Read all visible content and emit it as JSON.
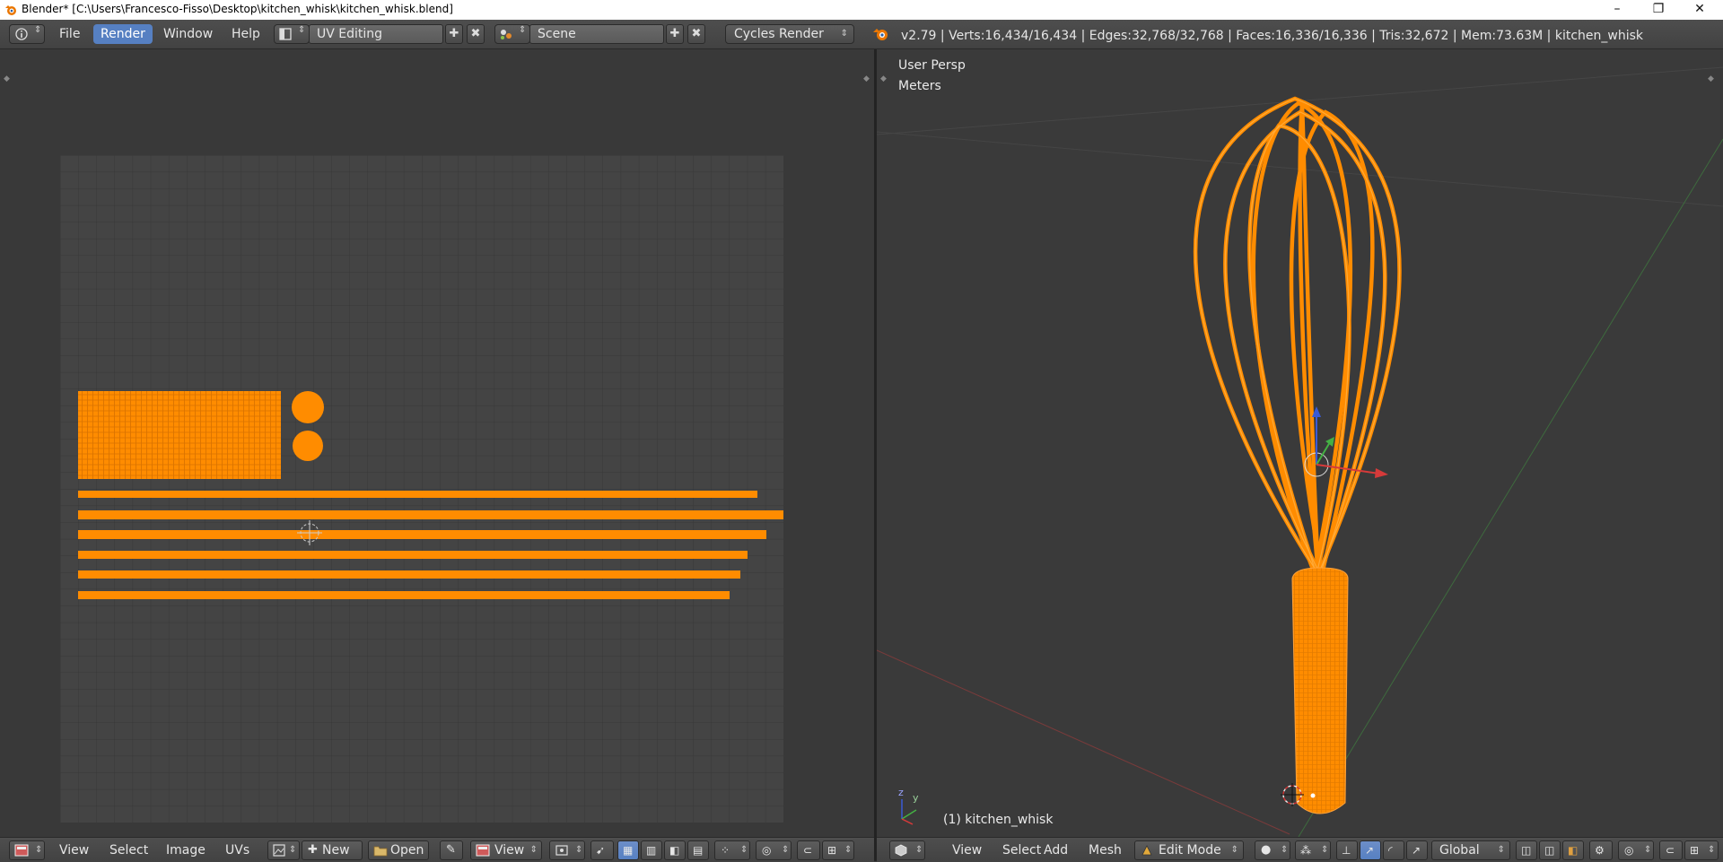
{
  "window": {
    "title": "Blender* [C:\\Users\\Francesco-Fisso\\Desktop\\kitchen_whisk\\kitchen_whisk.blend]",
    "minimize": "–",
    "restore": "❐",
    "close": "✕"
  },
  "info_header": {
    "menus": [
      "File",
      "Render",
      "Window",
      "Help"
    ],
    "active_menu": "Render",
    "screen_layout": "UV Editing",
    "scene": "Scene",
    "render_engine": "Cycles Render",
    "stats": "v2.79 | Verts:16,434/16,434 | Edges:32,768/32,768 | Faces:16,336/16,336 | Tris:32,672 | Mem:73.63M | kitchen_whisk"
  },
  "viewport": {
    "view_name": "User Persp",
    "units": "Meters",
    "object_label": "(1) kitchen_whisk",
    "axis_y": "y",
    "axis_z": "z"
  },
  "uv_header": {
    "menus": [
      "View",
      "Select",
      "Image",
      "UVs"
    ],
    "new_label": "New",
    "open_label": "Open",
    "view_label": "View"
  },
  "view3d_header": {
    "menus": [
      "View",
      "Select",
      "Add",
      "Mesh"
    ],
    "mode": "Edit Mode",
    "orientation": "Global"
  },
  "colors": {
    "mesh": "#ff8c00",
    "selected_menu": "#5680c2",
    "grid_bg": "#444444",
    "grid_line": "#383838"
  }
}
